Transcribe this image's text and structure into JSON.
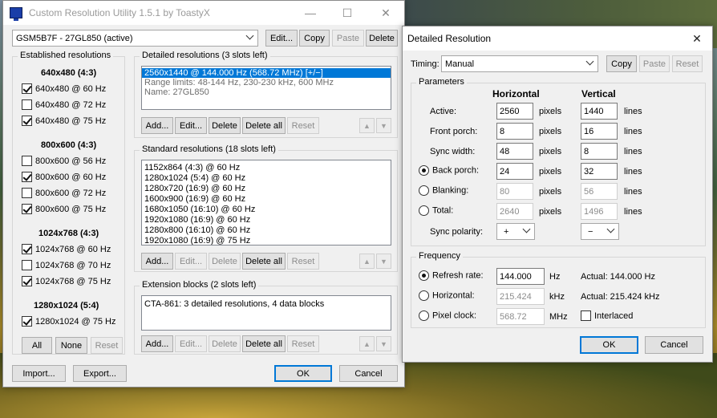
{
  "main": {
    "title": "Custom Resolution Utility 1.5.1 by ToastyX",
    "monitor": "GSM5B7F - 27GL850 (active)",
    "top_buttons": {
      "edit": "Edit...",
      "copy": "Copy",
      "paste": "Paste",
      "delete": "Delete"
    },
    "established": {
      "label": "Established resolutions",
      "groups": [
        {
          "header": "640x480 (4:3)",
          "items": [
            {
              "label": "640x480 @ 60 Hz",
              "checked": true
            },
            {
              "label": "640x480 @ 72 Hz",
              "checked": false
            },
            {
              "label": "640x480 @ 75 Hz",
              "checked": true
            }
          ]
        },
        {
          "header": "800x600 (4:3)",
          "items": [
            {
              "label": "800x600 @ 56 Hz",
              "checked": false
            },
            {
              "label": "800x600 @ 60 Hz",
              "checked": true
            },
            {
              "label": "800x600 @ 72 Hz",
              "checked": false
            },
            {
              "label": "800x600 @ 75 Hz",
              "checked": true
            }
          ]
        },
        {
          "header": "1024x768 (4:3)",
          "items": [
            {
              "label": "1024x768 @ 60 Hz",
              "checked": true
            },
            {
              "label": "1024x768 @ 70 Hz",
              "checked": false
            },
            {
              "label": "1024x768 @ 75 Hz",
              "checked": true
            }
          ]
        },
        {
          "header": "1280x1024 (5:4)",
          "items": [
            {
              "label": "1280x1024 @ 75 Hz",
              "checked": true
            }
          ]
        }
      ],
      "buttons": {
        "all": "All",
        "none": "None",
        "reset": "Reset"
      }
    },
    "detailed": {
      "label": "Detailed resolutions (3 slots left)",
      "items": [
        "2560x1440 @ 144.000 Hz (568.72 MHz) [+/−]",
        "Range limits: 48-144 Hz, 230-230 kHz, 600 MHz",
        "Name: 27GL850"
      ]
    },
    "standard": {
      "label": "Standard resolutions (18 slots left)",
      "items": [
        "1152x864 (4:3) @ 60 Hz",
        "1280x1024 (5:4) @ 60 Hz",
        "1280x720 (16:9) @ 60 Hz",
        "1600x900 (16:9) @ 60 Hz",
        "1680x1050 (16:10) @ 60 Hz",
        "1920x1080 (16:9) @ 60 Hz",
        "1280x800 (16:10) @ 60 Hz",
        "1920x1080 (16:9) @ 75 Hz"
      ]
    },
    "extension": {
      "label": "Extension blocks (2 slots left)",
      "items": [
        "CTA-861: 3 detailed resolutions, 4 data blocks"
      ]
    },
    "list_buttons": {
      "add": "Add...",
      "edit": "Edit...",
      "delete": "Delete",
      "delete_all": "Delete all",
      "reset": "Reset"
    },
    "bottom": {
      "import": "Import...",
      "export": "Export...",
      "ok": "OK",
      "cancel": "Cancel"
    }
  },
  "dialog": {
    "title": "Detailed Resolution",
    "timing_label": "Timing:",
    "timing_value": "Manual",
    "timing_buttons": {
      "copy": "Copy",
      "paste": "Paste",
      "reset": "Reset"
    },
    "parameters": {
      "label": "Parameters",
      "horizontal": "Horizontal",
      "vertical": "Vertical",
      "rows": [
        {
          "label": "Active:",
          "h": "2560",
          "h_unit": "pixels",
          "v": "1440",
          "v_unit": "lines"
        },
        {
          "label": "Front porch:",
          "h": "8",
          "h_unit": "pixels",
          "v": "16",
          "v_unit": "lines"
        },
        {
          "label": "Sync width:",
          "h": "48",
          "h_unit": "pixels",
          "v": "8",
          "v_unit": "lines"
        },
        {
          "label": "Back porch:",
          "h": "24",
          "h_unit": "pixels",
          "v": "32",
          "v_unit": "lines"
        },
        {
          "label": "Blanking:",
          "h": "80",
          "h_unit": "pixels",
          "v": "56",
          "v_unit": "lines"
        },
        {
          "label": "Total:",
          "h": "2640",
          "h_unit": "pixels",
          "v": "1496",
          "v_unit": "lines"
        }
      ],
      "sync_polarity_label": "Sync polarity:",
      "h_polarity": "+",
      "v_polarity": "−"
    },
    "frequency": {
      "label": "Frequency",
      "refresh_label": "Refresh rate:",
      "refresh_value": "144.000",
      "refresh_unit": "Hz",
      "refresh_actual": "Actual: 144.000 Hz",
      "horizontal_label": "Horizontal:",
      "horizontal_value": "215.424",
      "horizontal_unit": "kHz",
      "horizontal_actual": "Actual: 215.424 kHz",
      "pixel_label": "Pixel clock:",
      "pixel_value": "568.72",
      "pixel_unit": "MHz",
      "interlaced_label": "Interlaced"
    },
    "ok": "OK",
    "cancel": "Cancel"
  }
}
